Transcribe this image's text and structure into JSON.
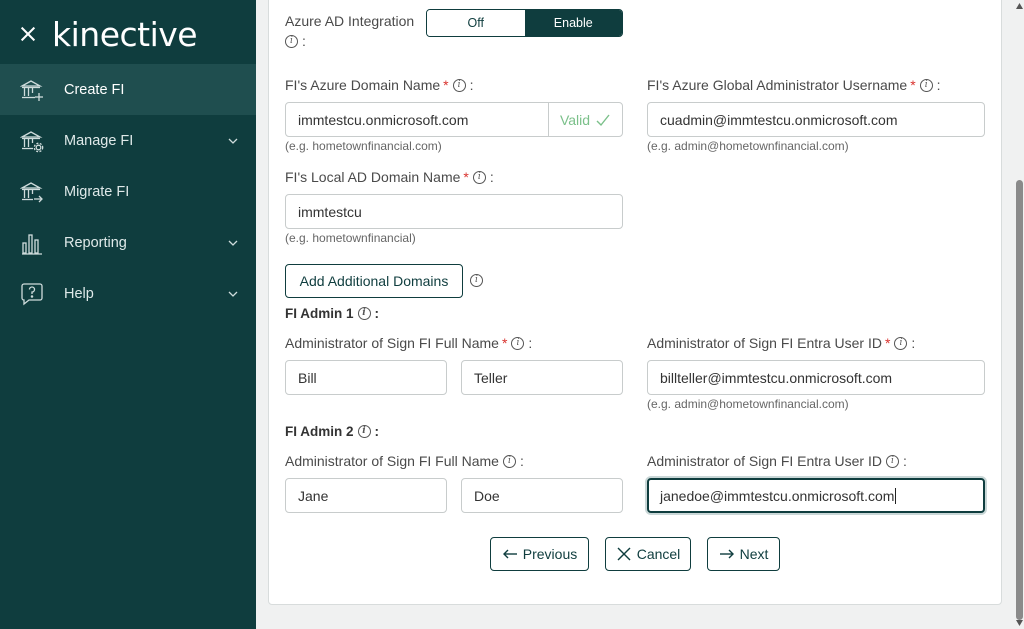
{
  "brand": {
    "logo": "kinective"
  },
  "nav": [
    {
      "label": "Create FI",
      "icon": "bank-add-icon",
      "active": true,
      "has_submenu": false
    },
    {
      "label": "Manage FI",
      "icon": "bank-gear-icon",
      "active": false,
      "has_submenu": true
    },
    {
      "label": "Migrate FI",
      "icon": "bank-arrow-icon",
      "active": false,
      "has_submenu": false
    },
    {
      "label": "Reporting",
      "icon": "bar-chart-icon",
      "active": false,
      "has_submenu": true
    },
    {
      "label": "Help",
      "icon": "help-bubble-icon",
      "active": false,
      "has_submenu": true
    }
  ],
  "azure_ad": {
    "label": "Azure AD Integration",
    "colon": ":",
    "options": [
      "Off",
      "Enable"
    ],
    "selected": "Enable"
  },
  "azure_domain": {
    "label": "FI's Azure Domain Name",
    "value": "immtestcu.onmicrosoft.com",
    "status": "Valid",
    "hint": "(e.g. hometownfinancial.com)"
  },
  "azure_admin": {
    "label": "FI's Azure Global Administrator Username",
    "value": "cuadmin@immtestcu.onmicrosoft.com",
    "hint": "(e.g. admin@hometownfinancial.com)"
  },
  "local_domain": {
    "label": "FI's Local AD Domain Name",
    "value": "immtestcu",
    "hint": "(e.g. hometownfinancial)"
  },
  "add_domains_button": "Add Additional Domains",
  "admin1": {
    "section": "FI Admin 1",
    "name_label": "Administrator of Sign FI Full Name",
    "first": "Bill",
    "last": "Teller",
    "id_label": "Administrator of Sign FI Entra User ID",
    "user_id": "billteller@immtestcu.onmicrosoft.com",
    "hint": "(e.g. admin@hometownfinancial.com)"
  },
  "admin2": {
    "section": "FI Admin 2",
    "name_label": "Administrator of Sign FI Full Name",
    "first": "Jane",
    "last": "Doe",
    "id_label": "Administrator of Sign FI Entra User ID",
    "user_id": "janedoe@immtestcu.onmicrosoft.com"
  },
  "actions": {
    "previous": "Previous",
    "cancel": "Cancel",
    "next": "Next"
  },
  "colors": {
    "sidebar": "#0f3d3e",
    "active_nav": "#1f4e4f",
    "accent": "#0f3d3e",
    "valid": "#7bc08a",
    "required": "#d9322e"
  }
}
